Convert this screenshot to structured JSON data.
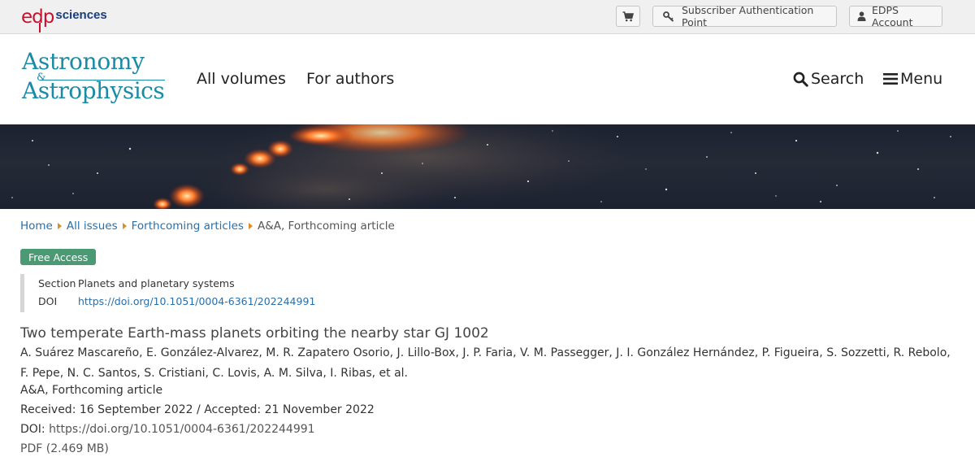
{
  "topbar": {
    "publisher_logo": {
      "mark": "edp",
      "name": "sciences"
    },
    "cart_icon": "cart-icon",
    "auth_label": "Subscriber Authentication Point",
    "account_label": "EDPS Account"
  },
  "header": {
    "journal_logo": {
      "line1": "Astronomy",
      "amp": "&",
      "line2": "Astrophysics"
    },
    "nav": {
      "volumes": "All volumes",
      "authors": "For authors"
    },
    "search_label": "Search",
    "menu_label": "Menu"
  },
  "breadcrumb": {
    "items": [
      "Home",
      "All issues",
      "Forthcoming articles"
    ],
    "current": "A&A, Forthcoming article"
  },
  "badge": "Free Access",
  "meta": {
    "section_label": "Section",
    "section_value": "Planets and planetary systems",
    "doi_label": "DOI",
    "doi_value": "https://doi.org/10.1051/0004-6361/202244991"
  },
  "article": {
    "title": "Two temperate Earth-mass planets orbiting the nearby star GJ 1002",
    "authors": "A. Suárez Mascareño, E. González-Alvarez, M. R. Zapatero Osorio, J. Lillo-Box, J. P. Faria, V. M. Passegger, J. I. González Hernández, P. Figueira, S. Sozzetti, R. Rebolo, F. Pepe, N. C. Santos, S. Cristiani, C. Lovis, A. M. Silva, I. Ribas, et al.",
    "journal": "A&A, Forthcoming article",
    "dates": "Received: 16 September 2022 / Accepted: 21 November 2022",
    "doi_label": "DOI:",
    "doi_value": "https://doi.org/10.1051/0004-6361/202244991",
    "pdf": "PDF (2.469 MB)"
  },
  "colors": {
    "link": "#2a6fa8",
    "badge": "#4a9a74",
    "journal_logo": "#1a8ba6",
    "breadcrumb_arrow": "#e08a2c",
    "publisher_red": "#c8102e",
    "publisher_blue": "#1b3c78"
  }
}
